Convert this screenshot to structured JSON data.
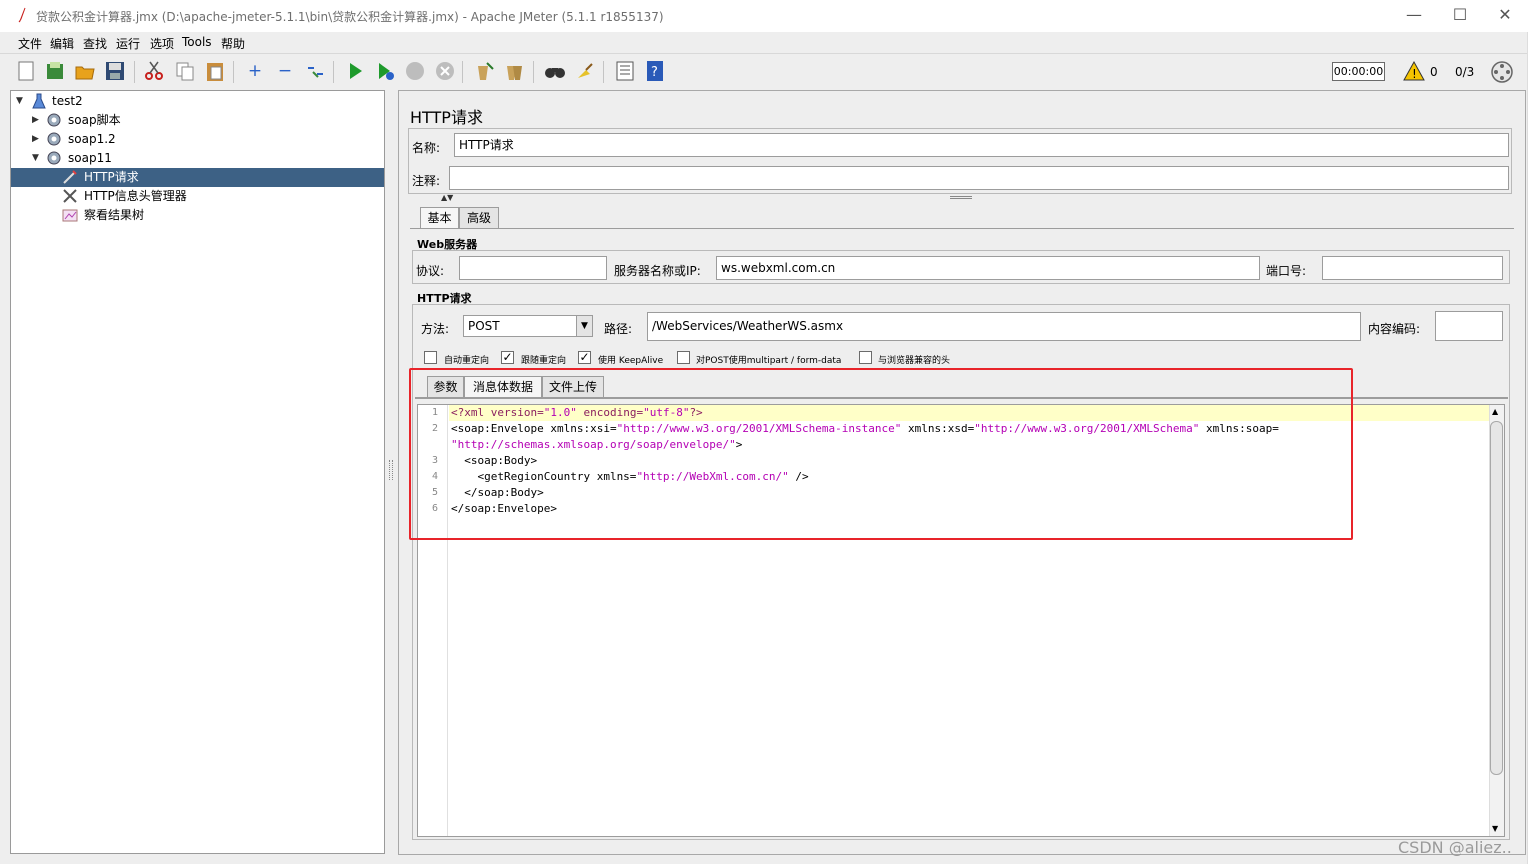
{
  "window": {
    "title": "贷款公积金计算器.jmx (D:\\apache-jmeter-5.1.1\\bin\\贷款公积金计算器.jmx) - Apache JMeter (5.1.1 r1855137)",
    "minimize": "—",
    "maximize": "☐",
    "close": "✕"
  },
  "menu": [
    "文件",
    "编辑",
    "查找",
    "运行",
    "选项",
    "Tools",
    "帮助"
  ],
  "toolbar": {
    "icons": [
      "new-icon",
      "templates-icon",
      "open-icon",
      "save-icon",
      "cut-icon",
      "copy-icon",
      "paste-icon",
      "expand-icon",
      "collapse-icon",
      "toggle-icon",
      "start-icon",
      "start-no-pause-icon",
      "stop-icon",
      "shutdown-icon",
      "clear-icon",
      "clear-all-icon",
      "search-icon",
      "reset-search-icon",
      "function-helper-icon",
      "help-icon"
    ],
    "timer": "00:00:00",
    "warnings": "0",
    "threads": "0/3"
  },
  "tree": [
    {
      "label": "test2",
      "level": 0,
      "icon": "test-plan-icon",
      "arrow": "▼",
      "selected": false
    },
    {
      "label": "soap脚本",
      "level": 1,
      "icon": "thread-group-icon",
      "arrow": "▶",
      "selected": false
    },
    {
      "label": "soap1.2",
      "level": 1,
      "icon": "thread-group-icon",
      "arrow": "▶",
      "selected": false
    },
    {
      "label": "soap11",
      "level": 1,
      "icon": "thread-group-icon",
      "arrow": "▼",
      "selected": false
    },
    {
      "label": "HTTP请求",
      "level": 2,
      "icon": "sampler-icon",
      "arrow": "",
      "selected": true
    },
    {
      "label": "HTTP信息头管理器",
      "level": 2,
      "icon": "config-icon",
      "arrow": "",
      "selected": false
    },
    {
      "label": "察看结果树",
      "level": 2,
      "icon": "listener-icon",
      "arrow": "",
      "selected": false
    }
  ],
  "panel": {
    "title": "HTTP请求",
    "name_label": "名称:",
    "name_value": "HTTP请求",
    "comment_label": "注释:",
    "comment_value": "",
    "tabs": [
      "基本",
      "高级"
    ],
    "web_server": {
      "section": "Web服务器",
      "protocol_label": "协议:",
      "protocol_value": "",
      "server_label": "服务器名称或IP:",
      "server_value": "ws.webxml.com.cn",
      "port_label": "端口号:",
      "port_value": ""
    },
    "http_request": {
      "section": "HTTP请求",
      "method_label": "方法:",
      "method_value": "POST",
      "path_label": "路径:",
      "path_value": "/WebServices/WeatherWS.asmx",
      "encoding_label": "内容编码:",
      "encoding_value": ""
    },
    "options": [
      {
        "label": "自动重定向",
        "checked": false
      },
      {
        "label": "跟随重定向",
        "checked": true
      },
      {
        "label": "使用 KeepAlive",
        "checked": true
      },
      {
        "label": "对POST使用multipart / form-data",
        "checked": false
      },
      {
        "label": "与浏览器兼容的头",
        "checked": false
      }
    ],
    "body_tabs": [
      "参数",
      "消息体数据",
      "文件上传"
    ],
    "body_lines": [
      "1",
      "2",
      "3",
      "4",
      "5",
      "6"
    ]
  },
  "watermark": "CSDN @aliez.."
}
